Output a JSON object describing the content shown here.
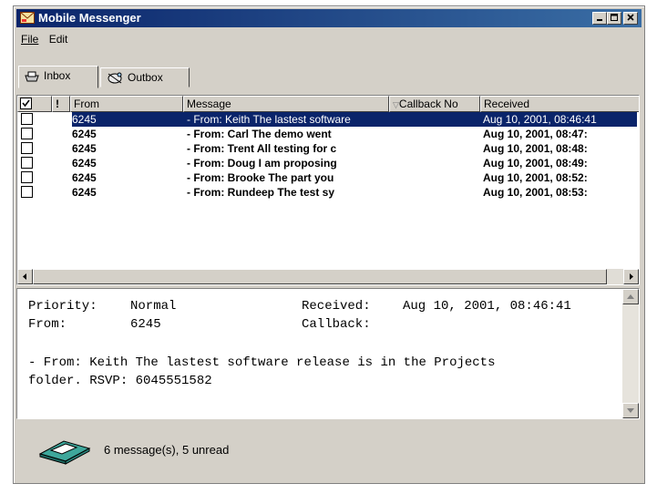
{
  "window": {
    "title": "Mobile Messenger",
    "controls": [
      "minimize",
      "maximize",
      "close"
    ]
  },
  "menu": [
    "File",
    "Edit"
  ],
  "tabs": [
    {
      "label": "Inbox",
      "icon": "inbox-tray-icon",
      "active": true
    },
    {
      "label": "Outbox",
      "icon": "outbox-satellite-icon",
      "active": false
    }
  ],
  "columns": {
    "check": "check-icon",
    "priority": "!",
    "from": "From",
    "message": "Message",
    "callback": "Callback No",
    "received": "Received"
  },
  "messages": [
    {
      "from": "6245",
      "message": "- From: Keith The lastest software",
      "received": "Aug 10, 2001, 08:46:41",
      "unread": false,
      "selected": true
    },
    {
      "from": "6245",
      "message": "- From: Carl The demo went",
      "received": "Aug 10, 2001, 08:47:",
      "unread": true,
      "selected": false
    },
    {
      "from": "6245",
      "message": "- From: Trent All testing for c",
      "received": "Aug 10, 2001, 08:48:",
      "unread": true,
      "selected": false
    },
    {
      "from": "6245",
      "message": "- From: Doug I am proposing",
      "received": "Aug 10, 2001, 08:49:",
      "unread": true,
      "selected": false
    },
    {
      "from": "6245",
      "message": "- From: Brooke The part you",
      "received": "Aug 10, 2001, 08:52:",
      "unread": true,
      "selected": false
    },
    {
      "from": "6245",
      "message": "- From: Rundeep The test sy",
      "received": "Aug 10, 2001, 08:53:",
      "unread": true,
      "selected": false
    }
  ],
  "preview": {
    "priority_label": "Priority:",
    "priority_value": "Normal",
    "from_label": "From:",
    "from_value": "6245",
    "received_label": "Received:",
    "received_value": "Aug 10, 2001, 08:46:41",
    "callback_label": "Callback:",
    "body_line1": "- From: Keith The lastest software release is in the Projects",
    "body_line2": "folder. RSVP: 6045551582"
  },
  "status": {
    "text": "6 message(s), 5 unread",
    "icon": "inbox-tray-icon"
  },
  "colors": {
    "titlebar": "#0a246a",
    "selection": "#0a246a",
    "face": "#d4d0c8"
  }
}
